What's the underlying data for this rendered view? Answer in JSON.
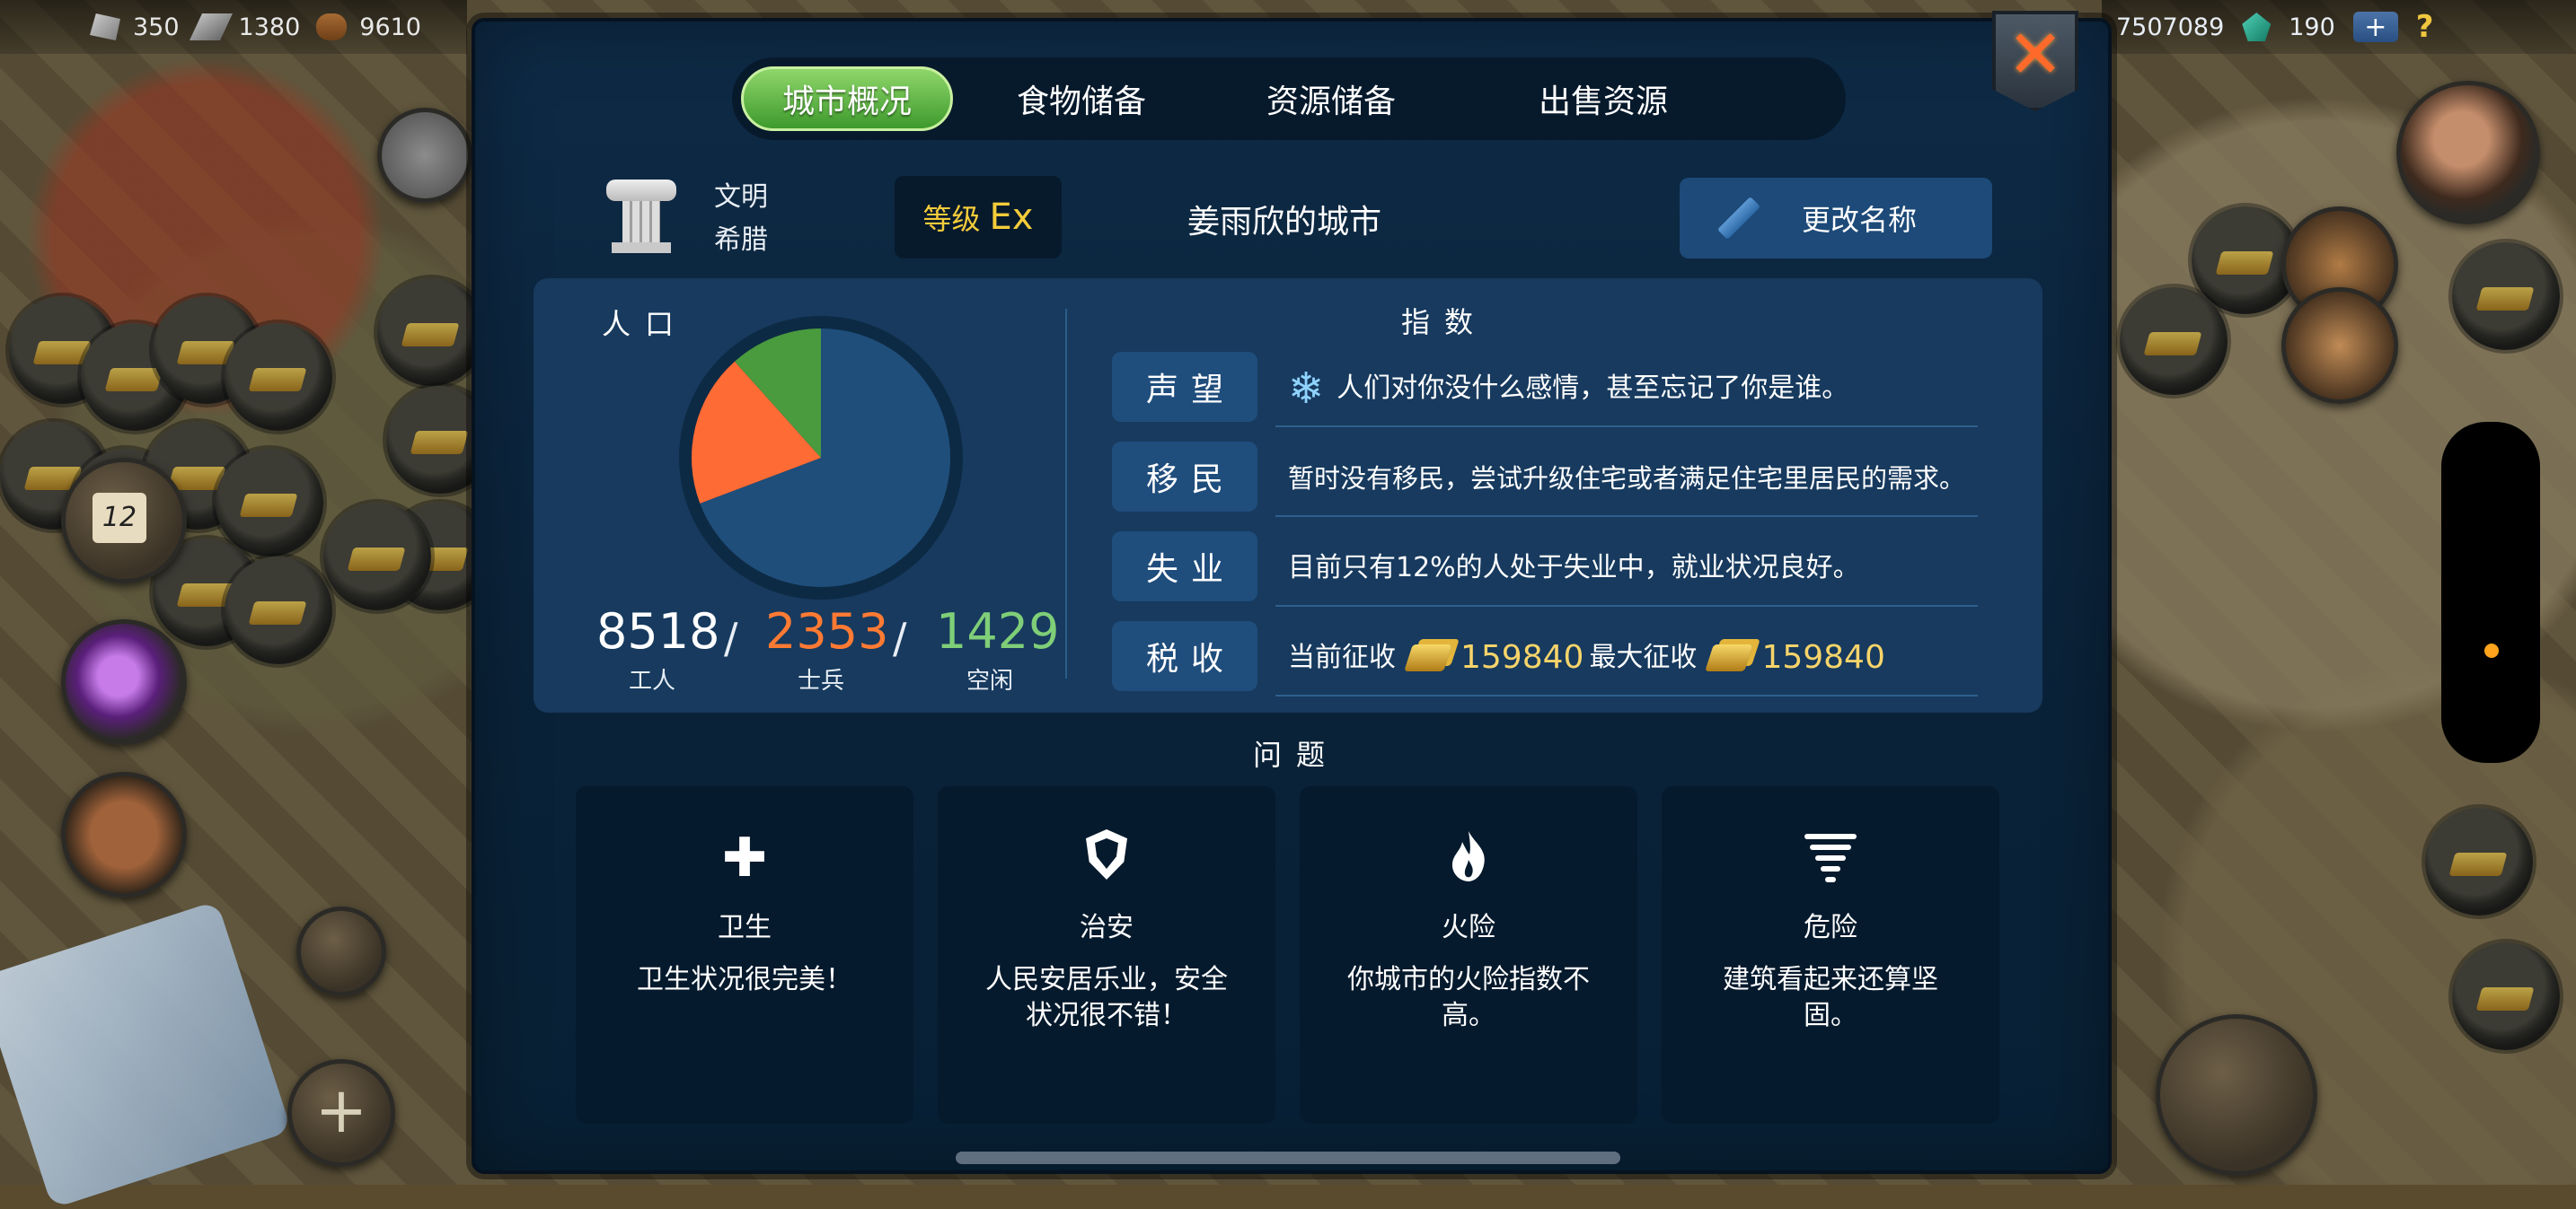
{
  "hud": {
    "stone": "350",
    "iron": "1380",
    "wood": "9610",
    "gold": "7507089",
    "gems": "190",
    "plus": "+",
    "help": "?"
  },
  "side": {
    "calendar_day": "12",
    "add": "+"
  },
  "dialog": {
    "close_icon": "close-x-icon",
    "tabs": [
      "城市概况",
      "食物储备",
      "资源储备",
      "出售资源"
    ],
    "active_tab": 0,
    "civ_label": "文明",
    "civ_name": "希腊",
    "level_label": "等级",
    "level_value": "Ex",
    "city_name": "姜雨欣的城市",
    "rename_label": "更改名称",
    "population": {
      "title": "人口",
      "workers": "8518",
      "workers_label": "工人",
      "soldiers": "2353",
      "soldiers_label": "士兵",
      "idle": "1429",
      "idle_label": "空闲",
      "colors": {
        "workers": "#1f4e7a",
        "soldiers": "#ff6b35",
        "idle": "#4a9a3e"
      }
    },
    "indices": {
      "title": "指数",
      "rows": [
        {
          "key": "声望",
          "text": "人们对你没什么感情，甚至忘记了你是谁。"
        },
        {
          "key": "移民",
          "text": "暂时没有移民，尝试升级住宅或者满足住宅里居民的需求。"
        },
        {
          "key": "失业",
          "text": "目前只有12%的人处于失业中，就业状况良好。"
        },
        {
          "key": "税收",
          "current_label": "当前征收",
          "current_value": "159840",
          "max_label": "最大征收",
          "max_value": "159840"
        }
      ]
    },
    "issues": {
      "title": "问题",
      "cards": [
        {
          "name": "卫生",
          "icon": "cross-icon",
          "desc": "卫生状况很完美！"
        },
        {
          "name": "治安",
          "icon": "shield-icon",
          "desc": "人民安居乐业，安全状况很不错！"
        },
        {
          "name": "火险",
          "icon": "fire-icon",
          "desc": "你城市的火险指数不高。"
        },
        {
          "name": "危险",
          "icon": "tornado-icon",
          "desc": "建筑看起来还算坚固。"
        }
      ]
    }
  }
}
